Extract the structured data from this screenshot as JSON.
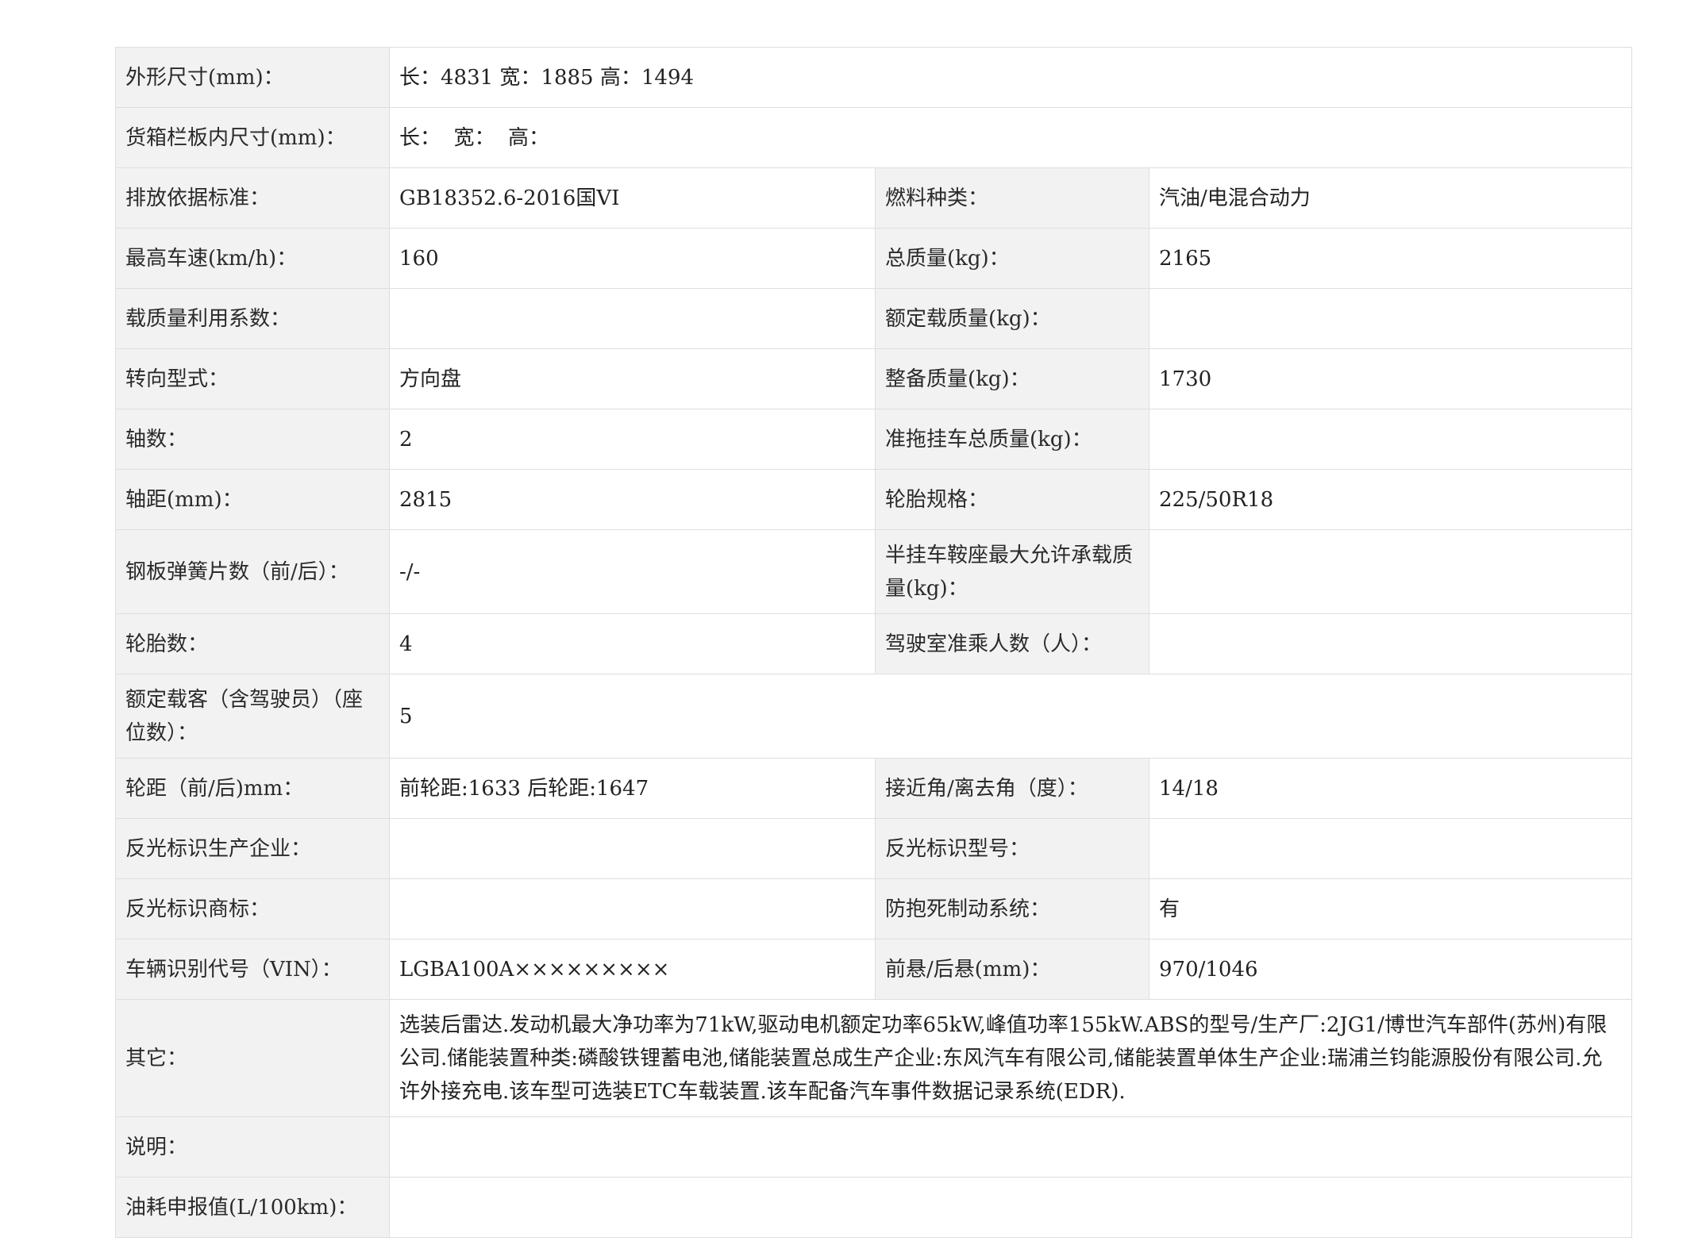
{
  "rows": [
    {
      "l1": "外形尺寸(mm)：",
      "v1": "长：4831 宽：1885 高：1494"
    },
    {
      "l1": "货箱栏板内尺寸(mm)：",
      "v1": "长：  宽：  高："
    },
    {
      "l1": "排放依据标准：",
      "v1": "GB18352.6-2016国VI",
      "l2": "燃料种类：",
      "v2": "汽油/电混合动力"
    },
    {
      "l1": "最高车速(km/h)：",
      "v1": "160",
      "l2": "总质量(kg)：",
      "v2": "2165"
    },
    {
      "l1": "载质量利用系数：",
      "v1": "",
      "l2": "额定载质量(kg)：",
      "v2": ""
    },
    {
      "l1": "转向型式：",
      "v1": "方向盘",
      "l2": "整备质量(kg)：",
      "v2": "1730"
    },
    {
      "l1": "轴数：",
      "v1": "2",
      "l2": "准拖挂车总质量(kg)：",
      "v2": ""
    },
    {
      "l1": "轴距(mm)：",
      "v1": "2815",
      "l2": "轮胎规格：",
      "v2": "225/50R18"
    },
    {
      "l1": "钢板弹簧片数（前/后）：",
      "v1": "-/-",
      "l2": "半挂车鞍座最大允许承载质量(kg)：",
      "v2": ""
    },
    {
      "l1": "轮胎数：",
      "v1": "4",
      "l2": "驾驶室准乘人数（人）：",
      "v2": ""
    },
    {
      "l1": "额定载客（含驾驶员）（座位数）：",
      "v1": "5"
    },
    {
      "l1": "轮距（前/后)mm：",
      "v1": "前轮距:1633 后轮距:1647",
      "l2": "接近角/离去角（度）：",
      "v2": "14/18"
    },
    {
      "l1": "反光标识生产企业：",
      "v1": "",
      "l2": "反光标识型号：",
      "v2": ""
    },
    {
      "l1": "反光标识商标：",
      "v1": "",
      "l2": "防抱死制动系统：",
      "v2": "有"
    },
    {
      "l1": "车辆识别代号（VIN）：",
      "v1": "LGBA100A×××××××××",
      "l2": "前悬/后悬(mm)：",
      "v2": "970/1046"
    },
    {
      "l1": "其它：",
      "v1": "选装后雷达.发动机最大净功率为71kW,驱动电机额定功率65kW,峰值功率155kW.ABS的型号/生产厂:2JG1/博世汽车部件(苏州)有限公司.储能装置种类:磷酸铁锂蓄电池,储能装置总成生产企业:东风汽车有限公司,储能装置单体生产企业:瑞浦兰钧能源股份有限公司.允许外接充电.该车型可选装ETC车载装置.该车配备汽车事件数据记录系统(EDR)."
    },
    {
      "l1": "说明：",
      "v1": ""
    },
    {
      "l1": "油耗申报值(L/100km)：",
      "v1": ""
    }
  ]
}
